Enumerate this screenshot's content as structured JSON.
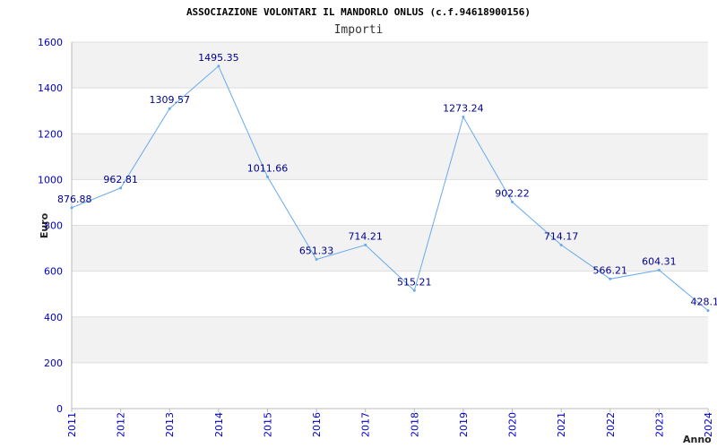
{
  "chart_data": {
    "type": "line",
    "title": "ASSOCIAZIONE VOLONTARI IL MANDORLO ONLUS (c.f.94618900156)",
    "subtitle": "Importi",
    "xlabel": "Anno",
    "ylabel": "Euro",
    "x": [
      "2011",
      "2012",
      "2013",
      "2014",
      "2015",
      "2016",
      "2017",
      "2018",
      "2019",
      "2020",
      "2021",
      "2022",
      "2023",
      "2024"
    ],
    "series": [
      {
        "values": [
          876.88,
          962.81,
          1309.57,
          1495.35,
          1011.66,
          651.33,
          714.21,
          515.21,
          1273.24,
          902.22,
          714.17,
          566.21,
          604.31,
          428.1
        ]
      }
    ],
    "data_labels": [
      "876.88",
      "962.81",
      "1309.57",
      "1495.35",
      "1011.66",
      "651.33",
      "714.21",
      "515.21",
      "1273.24",
      "902.22",
      "714.17",
      "566.21",
      "604.31",
      "428.1"
    ],
    "yticks": [
      "0",
      "200",
      "400",
      "600",
      "800",
      "1000",
      "1200",
      "1400",
      "1600"
    ],
    "ylim": [
      0,
      1600
    ],
    "grid": true,
    "band_colors": [
      "#f2f2f2",
      "#ffffff"
    ],
    "line_color": "#66aaee",
    "tick_color": "#0000cc"
  }
}
